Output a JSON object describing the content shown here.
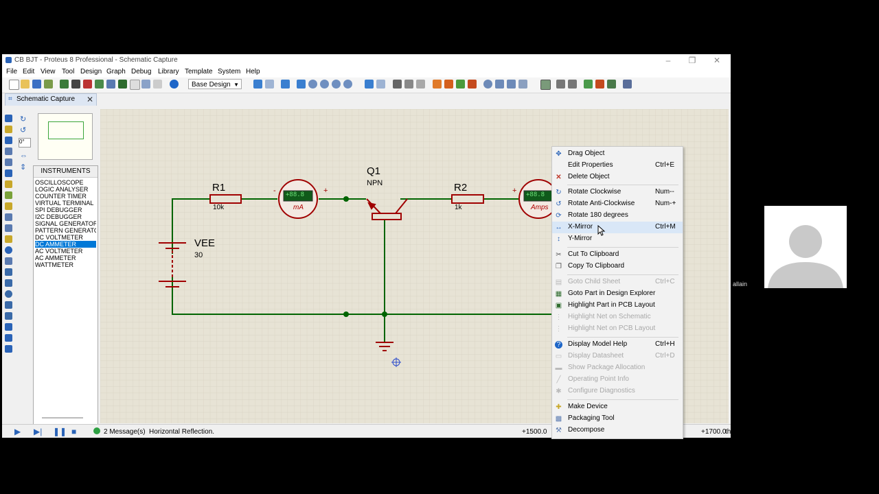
{
  "window": {
    "title": "CB BJT - Proteus 8 Professional - Schematic Capture",
    "controls": [
      "–",
      "❐",
      "✕"
    ]
  },
  "menu": [
    "File",
    "Edit",
    "View",
    "Tool",
    "Design",
    "Graph",
    "Debug",
    "Library",
    "Template",
    "System",
    "Help"
  ],
  "toolbar": {
    "design_combo": "Base Design"
  },
  "tab": {
    "label": "Schematic Capture",
    "close": "✕"
  },
  "left_panel": {
    "angle_value": "0°",
    "instruments_header": "INSTRUMENTS",
    "instruments": [
      "OSCILLOSCOPE",
      "LOGIC ANALYSER",
      "COUNTER TIMER",
      "VIRTUAL TERMINAL",
      "SPI DEBUGGER",
      "I2C DEBUGGER",
      "SIGNAL GENERATOR",
      "PATTERN GENERATO",
      "DC VOLTMETER",
      "DC AMMETER",
      "AC VOLTMETER",
      "AC AMMETER",
      "WATTMETER"
    ],
    "selected_instrument": "DC AMMETER"
  },
  "schematic": {
    "r1_name": "R1",
    "r1_value": "10k",
    "r2_name": "R2",
    "r2_value": "1k",
    "q1_name": "Q1",
    "q1_type": "NPN",
    "vee_name": "VEE",
    "vee_value": "30",
    "meter1_display": "+88.8",
    "meter1_unit": "mA",
    "meter2_display": "+88.8",
    "meter2_unit": "Amps",
    "minus": "-",
    "plus": "+"
  },
  "context_menu": [
    {
      "label": "Drag Object",
      "shortcut": "",
      "icon": "move-icon",
      "disabled": false
    },
    {
      "label": "Edit Properties",
      "shortcut": "Ctrl+E",
      "icon": "",
      "disabled": false
    },
    {
      "label": "Delete Object",
      "shortcut": "",
      "icon": "delete-icon",
      "disabled": false
    },
    {
      "label": "Rotate Clockwise",
      "shortcut": "Num--",
      "icon": "rotate-cw-icon",
      "disabled": false
    },
    {
      "label": "Rotate Anti-Clockwise",
      "shortcut": "Num-+",
      "icon": "rotate-ccw-icon",
      "disabled": false
    },
    {
      "label": "Rotate 180 degrees",
      "shortcut": "",
      "icon": "rotate-180-icon",
      "disabled": false
    },
    {
      "label": "X-Mirror",
      "shortcut": "Ctrl+M",
      "icon": "x-mirror-icon",
      "disabled": false,
      "highlighted": true
    },
    {
      "label": "Y-Mirror",
      "shortcut": "",
      "icon": "y-mirror-icon",
      "disabled": false
    },
    {
      "label": "Cut To Clipboard",
      "shortcut": "",
      "icon": "cut-icon",
      "disabled": false
    },
    {
      "label": "Copy To Clipboard",
      "shortcut": "",
      "icon": "copy-icon",
      "disabled": false
    },
    {
      "label": "Goto Child Sheet",
      "shortcut": "Ctrl+C",
      "icon": "child-sheet-icon",
      "disabled": true
    },
    {
      "label": "Goto Part in Design Explorer",
      "shortcut": "",
      "icon": "explorer-icon",
      "disabled": false
    },
    {
      "label": "Highlight Part in PCB Layout",
      "shortcut": "",
      "icon": "pcb-icon",
      "disabled": false
    },
    {
      "label": "Highlight Net on Schematic",
      "shortcut": "",
      "icon": "net-icon",
      "disabled": true
    },
    {
      "label": "Highlight Net on PCB Layout",
      "shortcut": "",
      "icon": "net-pcb-icon",
      "disabled": true
    },
    {
      "label": "Display Model Help",
      "shortcut": "Ctrl+H",
      "icon": "help-icon",
      "disabled": false
    },
    {
      "label": "Display Datasheet",
      "shortcut": "Ctrl+D",
      "icon": "datasheet-icon",
      "disabled": true
    },
    {
      "label": "Show Package Allocation",
      "shortcut": "",
      "icon": "package-icon",
      "disabled": true
    },
    {
      "label": "Operating Point Info",
      "shortcut": "",
      "icon": "probe-icon",
      "disabled": true
    },
    {
      "label": "Configure Diagnostics",
      "shortcut": "",
      "icon": "diagnostics-icon",
      "disabled": true
    },
    {
      "label": "Make Device",
      "shortcut": "",
      "icon": "make-device-icon",
      "disabled": false
    },
    {
      "label": "Packaging Tool",
      "shortcut": "",
      "icon": "packaging-icon",
      "disabled": false
    },
    {
      "label": "Decompose",
      "shortcut": "",
      "icon": "decompose-icon",
      "disabled": false
    }
  ],
  "status": {
    "messages": "2 Message(s)",
    "hint": "Horizontal Reflection.",
    "coord_x": "+1500.0",
    "coord_y": "+1700.0",
    "units": "th"
  },
  "video_participant": {
    "name": "allain"
  },
  "colors": {
    "wire": "#006400",
    "component": "#a00000",
    "accent": "#0078d7",
    "sheet": "#e7e3d5"
  }
}
